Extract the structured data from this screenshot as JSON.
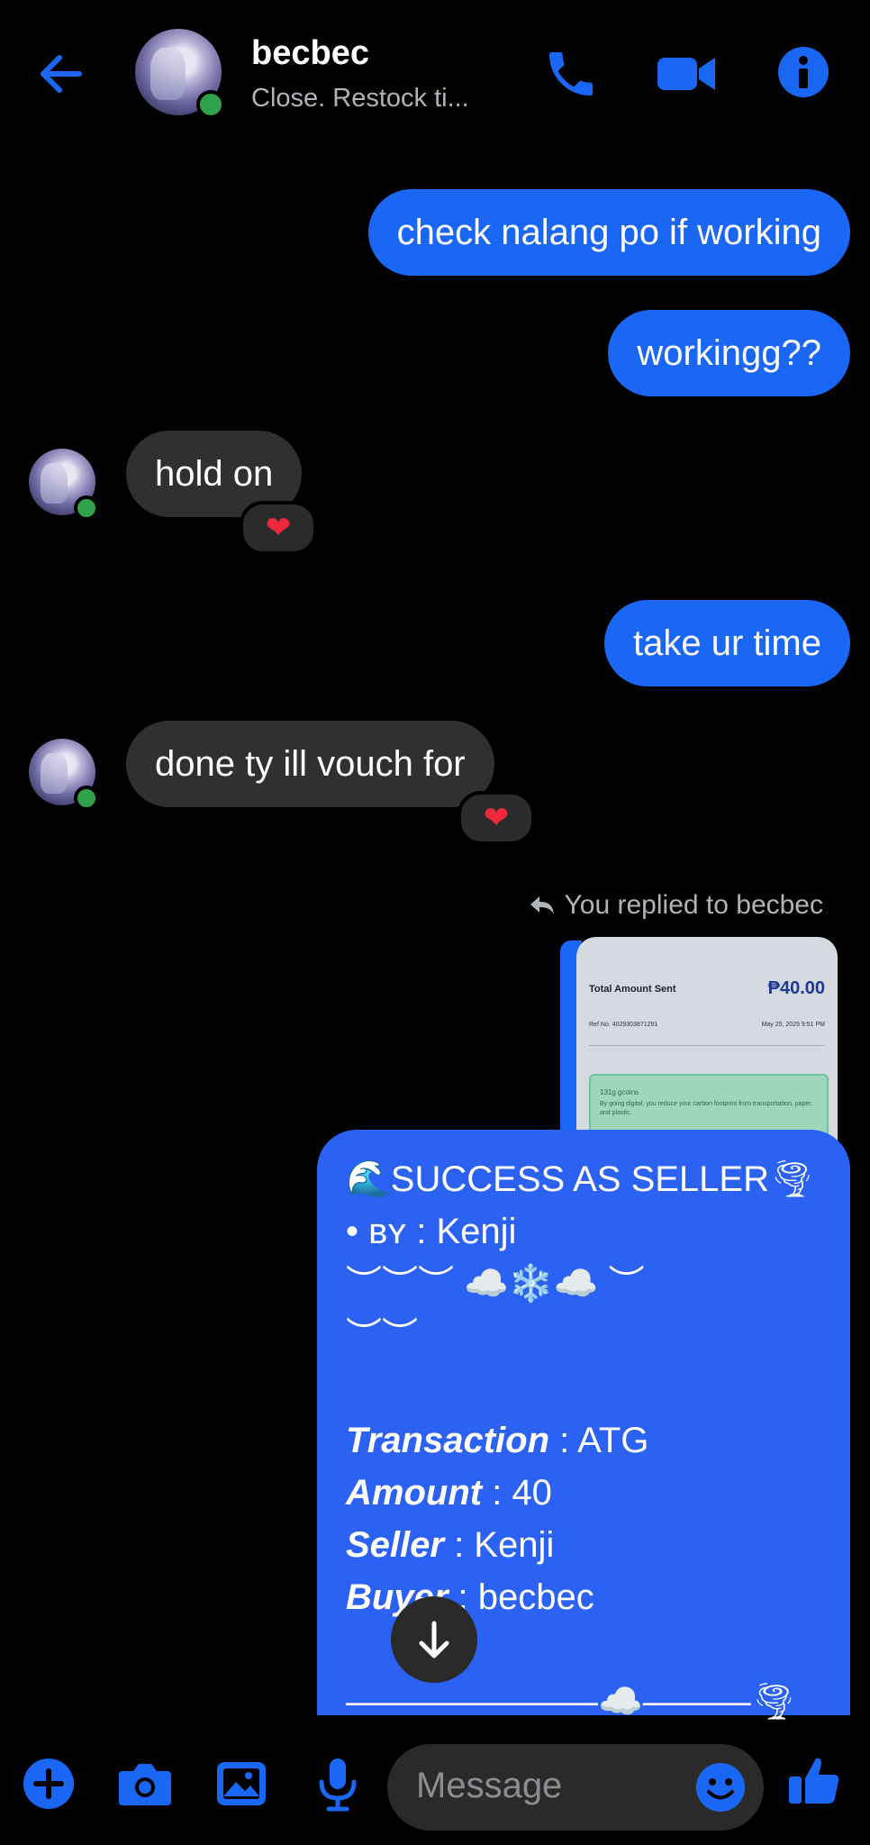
{
  "header": {
    "contact_name": "becbec",
    "status": "Close. Restock ti..."
  },
  "messages": [
    {
      "dir": "out",
      "text": "check nalang po if working"
    },
    {
      "dir": "out",
      "text": "workingg??"
    },
    {
      "dir": "in",
      "text": "hold on",
      "reaction": "❤"
    },
    {
      "dir": "out",
      "text": "take ur time"
    },
    {
      "dir": "in",
      "text": "done ty ill vouch for",
      "reaction": "❤"
    }
  ],
  "reply_note": "You replied to becbec",
  "receipt_thumb": {
    "amount_label": "Total Amount Sent",
    "amount_value": "₱40.00",
    "ref_label": "Ref No. 4029303871291",
    "date": "May 25, 2025 9:51 PM",
    "eco_title": "131g gcoins",
    "eco_text": "By going digital, you reduce your carbon footprint from transportation, paper, and plastic."
  },
  "card": {
    "heading": "🌊SUCCESS AS SELLER🌪",
    "by_line": "• ʙʏ : Kenji",
    "deco_1": "︶︶︶ ☁️❄️☁️ ︶",
    "deco_2": "︶︶",
    "transaction_label": "Transaction",
    "transaction_value": " : ATG",
    "amount_label": "Amount",
    "amount_value": " : 40",
    "seller_label": "Seller",
    "seller_value": " : Kenji",
    "buyer_label": "Buyer",
    "buyer_value": " : becbec",
    "footer_deco": "———————☁️———🌪"
  },
  "composer": {
    "placeholder": "Message"
  },
  "colors": {
    "accent": "#1a66f5",
    "card": "#2b62f4",
    "incoming": "#303030",
    "online": "#31a24c",
    "heart": "#f0283c"
  },
  "icons": [
    "back-arrow-icon",
    "phone-icon",
    "video-camera-icon",
    "info-icon",
    "reply-icon",
    "arrow-down-icon",
    "plus-icon",
    "camera-icon",
    "image-icon",
    "microphone-icon",
    "emoji-icon",
    "thumbs-up-icon"
  ]
}
